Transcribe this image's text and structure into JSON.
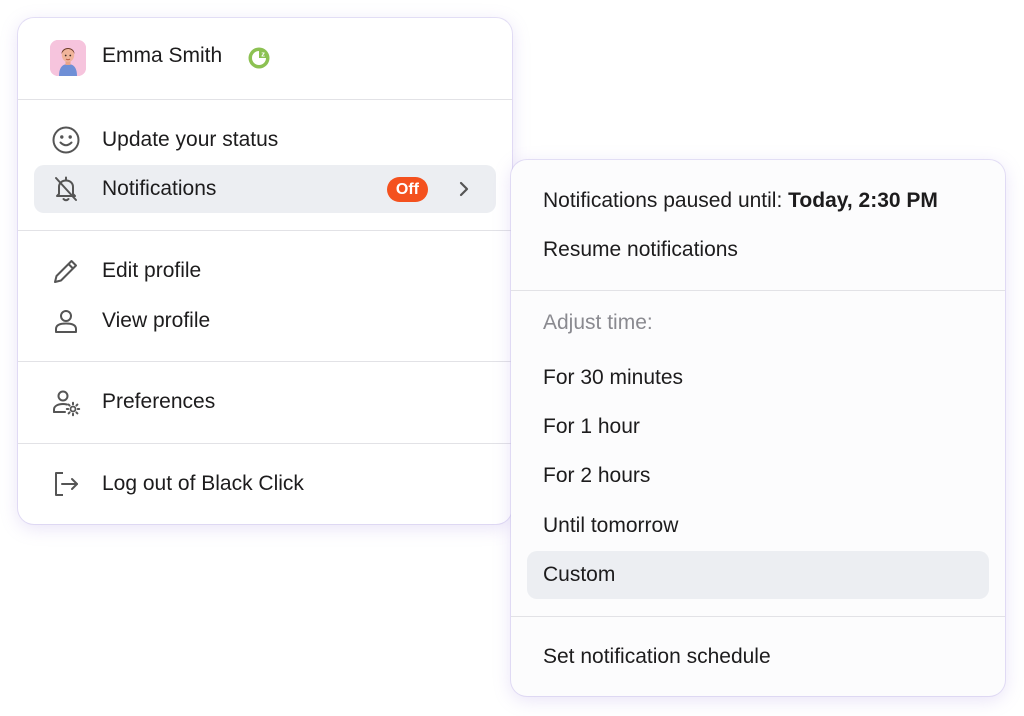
{
  "user": {
    "name": "Emma Smith",
    "avatar_icon": "avatar-image",
    "status_icon": "away-clock-icon",
    "status_color": "#8cc152"
  },
  "main_menu": {
    "items": [
      {
        "label": "Update your status",
        "icon": "smiley-icon"
      },
      {
        "label": "Notifications",
        "icon": "bell-off-icon",
        "badge": "Off"
      },
      {
        "label": "Edit profile",
        "icon": "pencil-icon"
      },
      {
        "label": "View profile",
        "icon": "person-icon"
      },
      {
        "label": "Preferences",
        "icon": "user-gear-icon"
      },
      {
        "label": "Log out of Black Click",
        "icon": "logout-icon"
      }
    ]
  },
  "notifications_submenu": {
    "paused_prefix": "Notifications paused until:",
    "paused_until": "Today, 2:30 PM",
    "resume_label": "Resume notifications",
    "adjust_heading": "Adjust time:",
    "options": [
      "For 30 minutes",
      "For 1 hour",
      "For 2 hours",
      "Until tomorrow",
      "Custom"
    ],
    "schedule_label": "Set notification schedule"
  },
  "colors": {
    "badge_off": "#f4511e",
    "highlight": "#eceef2",
    "menu_border": "#d8cdf3"
  }
}
